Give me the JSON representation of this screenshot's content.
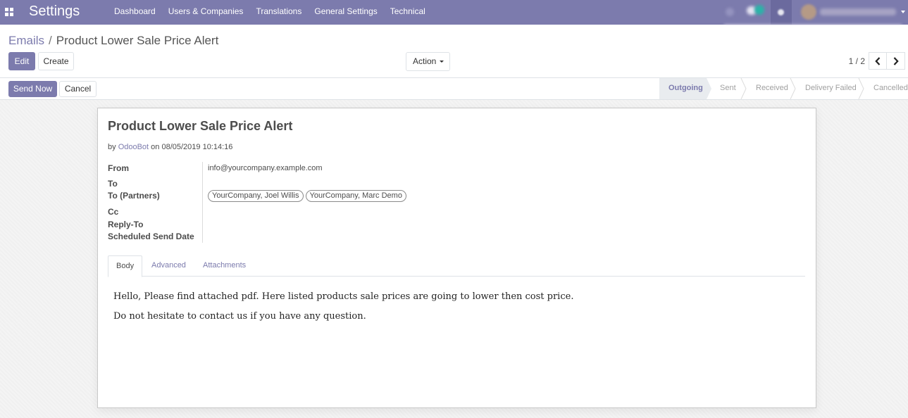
{
  "navbar": {
    "app_title": "Settings",
    "menu": [
      "Dashboard",
      "Users & Companies",
      "Translations",
      "General Settings",
      "Technical"
    ]
  },
  "breadcrumb": {
    "parent": "Emails",
    "separator": "/",
    "current": "Product Lower Sale Price Alert"
  },
  "buttons": {
    "edit": "Edit",
    "create": "Create",
    "action": "Action"
  },
  "pager": {
    "value": "1 / 2"
  },
  "statusbar": {
    "send_now": "Send Now",
    "cancel": "Cancel",
    "stages": [
      "Outgoing",
      "Sent",
      "Received",
      "Delivery Failed",
      "Cancelled"
    ],
    "current_stage": "Outgoing"
  },
  "mail": {
    "subject": "Product Lower Sale Price Alert",
    "meta_by": "by",
    "author": "OdooBot",
    "meta_on": "on 08/05/2019 10:14:16",
    "labels": {
      "from": "From",
      "to": "To",
      "to_partners": "To (Partners)",
      "cc": "Cc",
      "reply_to": "Reply-To",
      "scheduled": "Scheduled Send Date"
    },
    "from_value": "info@yourcompany.example.com",
    "partners": [
      "YourCompany, Joel Willis",
      "YourCompany, Marc Demo"
    ]
  },
  "tabs": [
    "Body",
    "Advanced",
    "Attachments"
  ],
  "body": [
    "Hello, Please find attached pdf. Here listed products sale prices are going to lower then cost price.",
    "Do not hesitate to contact us if you have any question."
  ],
  "colors": {
    "brand": "#7c7bad",
    "stage_active_bg": "#e9ecef",
    "text": "#4c4c4c"
  }
}
